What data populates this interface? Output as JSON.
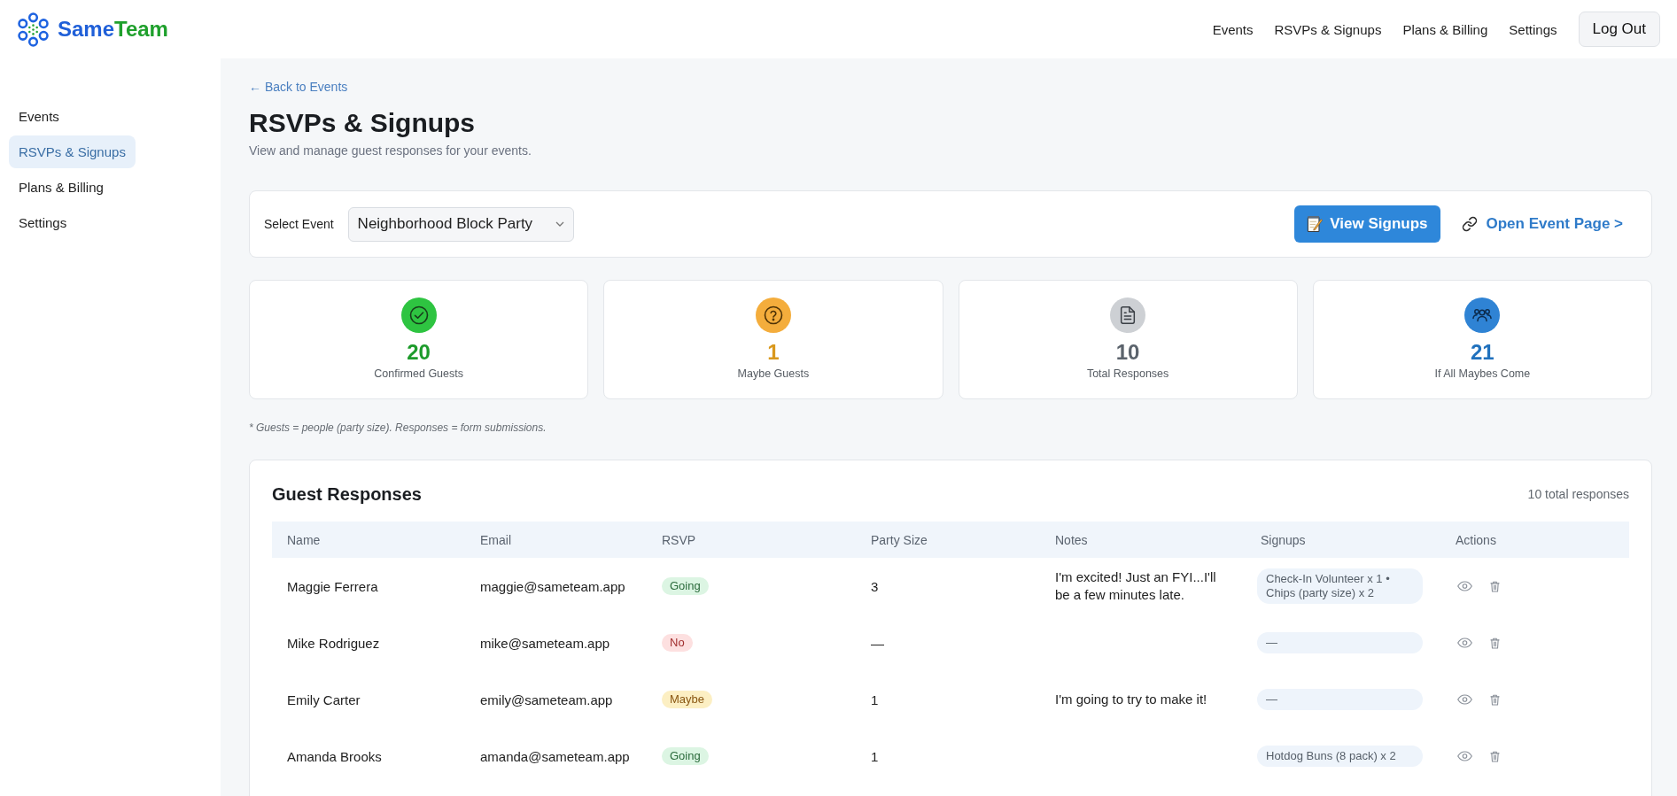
{
  "brand": {
    "name_parts": [
      "Same",
      "Team"
    ]
  },
  "top_nav": {
    "links": [
      "Events",
      "RSVPs & Signups",
      "Plans & Billing",
      "Settings"
    ],
    "logout_button": "Log Out"
  },
  "sidebar": {
    "items": [
      {
        "label": "Events",
        "selected": false
      },
      {
        "label": "RSVPs & Signups",
        "selected": true
      },
      {
        "label": "Plans & Billing",
        "selected": false
      },
      {
        "label": "Settings",
        "selected": false
      }
    ]
  },
  "page": {
    "back_link": "← Back to Events",
    "title": "RSVPs & Signups",
    "subtitle": "View and manage guest responses for your events."
  },
  "event_bar": {
    "label": "Select Event",
    "value": "Neighborhood Block Party",
    "view_button": "View Signups",
    "open_link": "Open Event Page >"
  },
  "stats": [
    {
      "kind": "check",
      "color": "#2ec441",
      "value": "20",
      "label": "Confirmed Guests"
    },
    {
      "kind": "question",
      "color": "#f4ad3c",
      "value": "1",
      "label": "Maybe Guests"
    },
    {
      "kind": "document",
      "color": "#cdd0d4",
      "value": "10",
      "label": "Total Responses"
    },
    {
      "kind": "group",
      "color": "#2f83d4",
      "value": "21",
      "label": "If All Maybes Come"
    }
  ],
  "footnote": "* Guests = people (party size). Responses = form submissions.",
  "responses": {
    "title": "Guest Responses",
    "count": "10 total responses",
    "columns": [
      "Name",
      "Email",
      "RSVP",
      "Party Size",
      "Notes",
      "Signups",
      "Actions"
    ],
    "rows": [
      {
        "name": "Maggie Ferrera",
        "email": "maggie@sameteam.app",
        "rsvp": {
          "label": "Going",
          "kind": "going"
        },
        "party_size": "3",
        "notes": "I'm excited! Just an FYI...I'll be a few minutes late.",
        "signups": "Check-In Volunteer x 1 • Chips (party size) x 2"
      },
      {
        "name": "Mike Rodriguez",
        "email": "mike@sameteam.app",
        "rsvp": {
          "label": "No",
          "kind": "no"
        },
        "party_size": "—",
        "signups": "—"
      },
      {
        "name": "Emily Carter",
        "email": "emily@sameteam.app",
        "rsvp": {
          "label": "Maybe",
          "kind": "maybe"
        },
        "party_size": "1",
        "notes": "I'm going to try to make it!",
        "signups": "—"
      },
      {
        "name": "Amanda Brooks",
        "email": "amanda@sameteam.app",
        "rsvp": {
          "label": "Going",
          "kind": "going"
        },
        "party_size": "1",
        "signups": "Hotdog Buns (8 pack) x 2"
      }
    ]
  }
}
